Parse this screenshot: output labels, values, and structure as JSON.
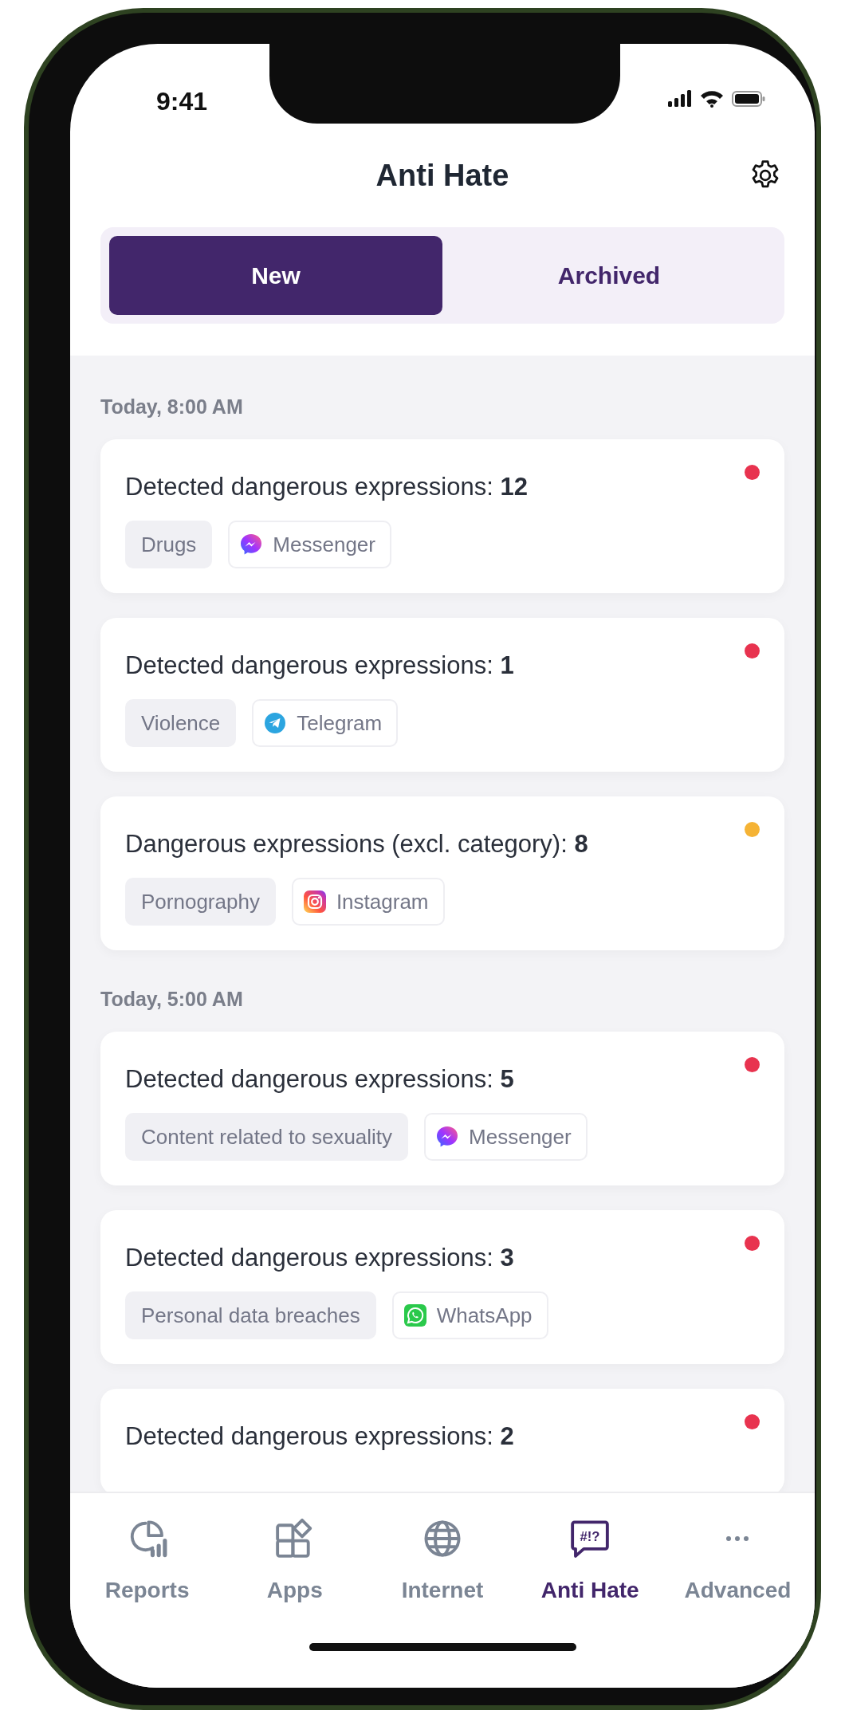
{
  "status_bar": {
    "time": "9:41"
  },
  "header": {
    "title": "Anti Hate"
  },
  "tabs": [
    {
      "label": "New",
      "selected": true
    },
    {
      "label": "Archived",
      "selected": false
    }
  ],
  "groups": [
    {
      "heading": "Today, 8:00 AM",
      "alerts": [
        {
          "text": "Detected dangerous expressions: **12**",
          "color": "#e8334f",
          "category": "Drugs",
          "app": "Messenger",
          "kind": "messenger"
        },
        {
          "text": "Detected dangerous expressions: **1**",
          "color": "#e8334f",
          "category": "Violence",
          "app": "Telegram",
          "kind": "telegram"
        },
        {
          "text": "Dangerous expressions (excl. category): **8**",
          "color": "#f5b335",
          "category": "Pornography",
          "app": "Instagram",
          "kind": "instagram"
        }
      ]
    },
    {
      "heading": "Today, 5:00 AM",
      "alerts": [
        {
          "text": "Detected dangerous expressions: **5**",
          "color": "#e8334f",
          "category": "Content related to sexuality",
          "app": "Messenger",
          "kind": "messenger"
        },
        {
          "text": "Detected dangerous expressions: **3**",
          "color": "#e8334f",
          "category": "Personal data breaches",
          "app": "WhatsApp",
          "kind": "whatsapp"
        },
        {
          "text": "Detected dangerous expressions: **2**",
          "color": "#e8334f"
        }
      ]
    }
  ],
  "nav": [
    {
      "label": "Reports",
      "kind": "reports",
      "selected": false
    },
    {
      "label": "Apps",
      "kind": "apps",
      "selected": false
    },
    {
      "label": "Internet",
      "kind": "internet",
      "selected": false
    },
    {
      "label": "Anti Hate",
      "kind": "antihate",
      "icon_text": "#!?",
      "selected": true
    },
    {
      "label": "Advanced",
      "kind": "more",
      "selected": false
    }
  ]
}
